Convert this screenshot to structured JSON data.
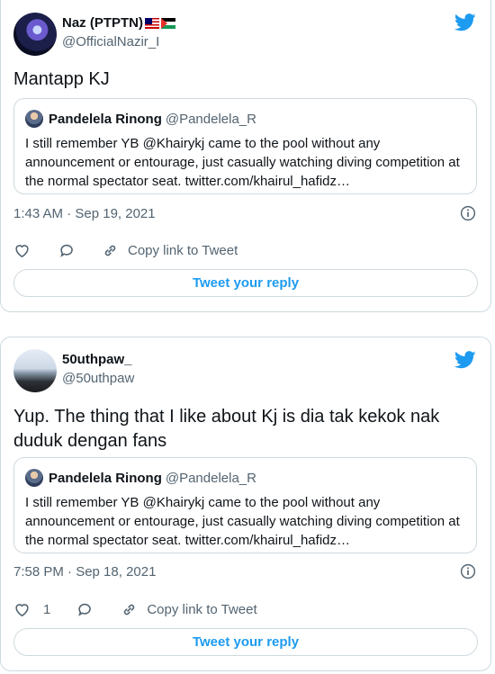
{
  "tweets": [
    {
      "author": {
        "name": "Naz (PTPTN)",
        "handle": "@OfficialNazir_I",
        "flags": [
          "malaysia-flag-icon",
          "palestine-flag-icon"
        ]
      },
      "text": "Mantapp KJ",
      "quote": {
        "name": "Pandelela Rinong",
        "handle": "@Pandelela_R",
        "text": "I still remember YB @Khairykj came to the pool without any announcement or entourage, just casually watching diving competition at the normal spectator seat. twitter.com/khairul_hafidz…"
      },
      "timestamp": "1:43 AM · Sep 19, 2021",
      "likes": "",
      "copy_link_label": "Copy link to Tweet",
      "reply_label": "Tweet your reply"
    },
    {
      "author": {
        "name": "50uthpaw_",
        "handle": "@50uthpaw"
      },
      "text": "Yup. The thing that I like about Kj is dia tak kekok nak duduk dengan fans",
      "quote": {
        "name": "Pandelela Rinong",
        "handle": "@Pandelela_R",
        "text": "I still remember YB @Khairykj came to the pool without any announcement or entourage, just casually watching diving competition at the normal spectator seat. twitter.com/khairul_hafidz…"
      },
      "timestamp": "7:58 PM · Sep 18, 2021",
      "likes": "1",
      "copy_link_label": "Copy link to Tweet",
      "reply_label": "Tweet your reply"
    }
  ],
  "colors": {
    "accent": "#1d9bf0",
    "text": "#0f1419",
    "muted": "#536471",
    "border": "#cfd9de"
  }
}
